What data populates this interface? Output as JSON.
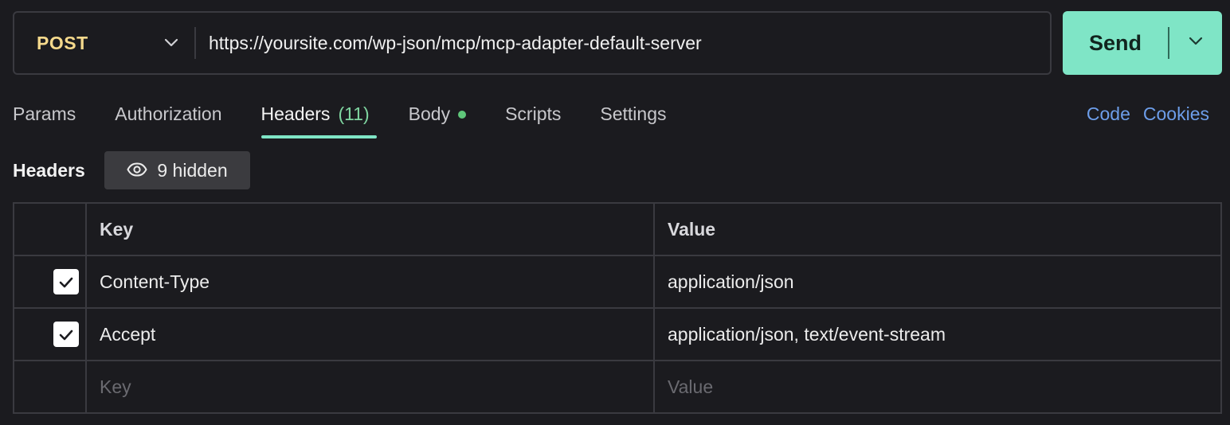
{
  "request": {
    "method": "POST",
    "url": "https://yoursite.com/wp-json/mcp/mcp-adapter-default-server",
    "send_label": "Send"
  },
  "tabs": [
    {
      "label": "Params"
    },
    {
      "label": "Authorization"
    },
    {
      "label": "Headers",
      "count": "(11)",
      "active": true
    },
    {
      "label": "Body",
      "has_content_dot": true
    },
    {
      "label": "Scripts"
    },
    {
      "label": "Settings"
    }
  ],
  "tab_links": {
    "code": "Code",
    "cookies": "Cookies"
  },
  "headers_section": {
    "title": "Headers",
    "hidden_label": "9 hidden",
    "columns": {
      "key": "Key",
      "value": "Value"
    },
    "rows": [
      {
        "enabled": true,
        "key": "Content-Type",
        "value": "application/json"
      },
      {
        "enabled": true,
        "key": "Accept",
        "value": "application/json, text/event-stream"
      }
    ],
    "new_row": {
      "key_placeholder": "Key",
      "value_placeholder": "Value"
    }
  },
  "icons": {
    "method_dropdown": "chevron-down-icon",
    "send_dropdown": "chevron-down-icon",
    "hidden_toggle": "eye-icon",
    "checkbox": "check-icon"
  },
  "colors": {
    "accent": "#7fe5c6",
    "method": "#f5d98c",
    "link": "#6d9eea",
    "count": "#7fd5a0",
    "dot": "#5fc77a",
    "background": "#1b1b1f"
  }
}
